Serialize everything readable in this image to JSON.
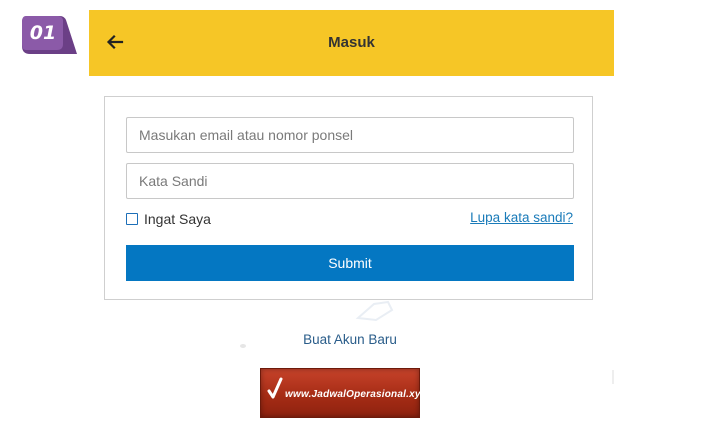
{
  "step_badge": {
    "label": "01",
    "color": "#8b5aa8"
  },
  "header": {
    "title": "Masuk",
    "back_icon": "arrow-left-icon",
    "background": "#f6c626"
  },
  "login_form": {
    "email_placeholder": "Masukan email atau nomor ponsel",
    "email_value": "",
    "password_placeholder": "Kata Sandi",
    "password_value": "",
    "remember_label": "Ingat Saya",
    "remember_checked": false,
    "forgot_label": "Lupa kata sandi?",
    "submit_label": "Submit",
    "submit_color": "#0477c2"
  },
  "create_account": {
    "label": "Buat Akun Baru"
  },
  "watermark": {
    "text": "www.JadwalOperasional.xyz",
    "icon": "checkmark-icon"
  }
}
